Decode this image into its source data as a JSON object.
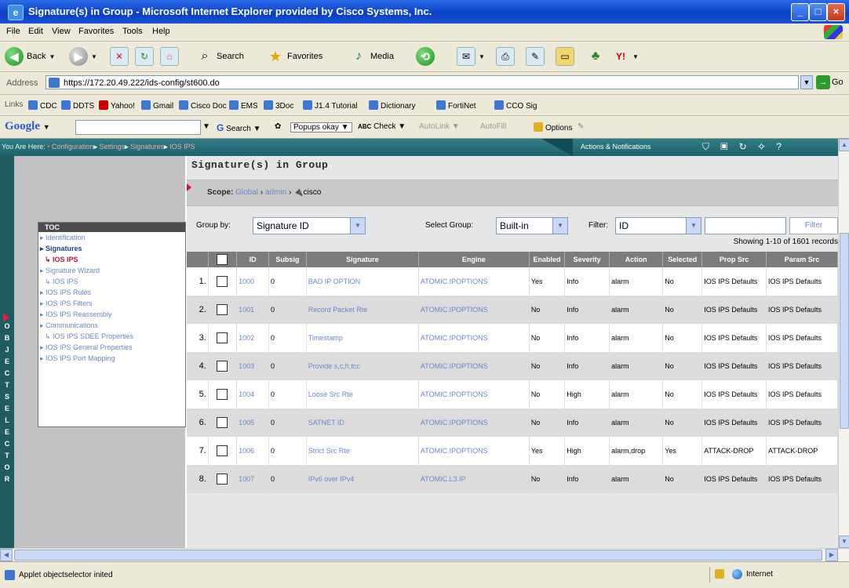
{
  "window": {
    "title": "Signature(s) in Group - Microsoft Internet Explorer provided by Cisco Systems, Inc."
  },
  "menu": [
    "File",
    "Edit",
    "View",
    "Favorites",
    "Tools",
    "Help"
  ],
  "toolbar": {
    "back": "Back",
    "search": "Search",
    "favorites": "Favorites",
    "media": "Media"
  },
  "address": {
    "label": "Address",
    "url": "https://172.20.49.222/ids-config/st600.do",
    "go": "Go"
  },
  "links": {
    "label": "Links",
    "items": [
      "CDC",
      "DDTS",
      "Yahoo!",
      "Gmail",
      "Cisco Doc",
      "EMS",
      "3Doc",
      "J1.4 Tutorial",
      "Dictionary",
      "FortiNet",
      "CCO Sig"
    ]
  },
  "googlebar": {
    "logo": "Google",
    "search": "Search",
    "popups": "Popups okay",
    "check": "Check",
    "autolink": "AutoLink",
    "autofill": "AutoFill",
    "options": "Options"
  },
  "topnav": {
    "you_are_here": "You Are Here:",
    "crumbs": [
      "Configuration",
      "Settings",
      "Signatures",
      "IOS IPS"
    ],
    "actions": "Actions & Notifications"
  },
  "selector": {
    "text": "OBJECT SELECTOR"
  },
  "toc": {
    "title": "TOC",
    "items": [
      {
        "label": "Identification",
        "style": "link"
      },
      {
        "label": "Signatures",
        "style": "bold"
      },
      {
        "label": "IOS IPS",
        "style": "red"
      },
      {
        "label": "Signature Wizard",
        "style": "link"
      },
      {
        "label": "IOS IPS",
        "style": "sub"
      },
      {
        "label": "IOS IPS Rules",
        "style": "link"
      },
      {
        "label": "IOS IPS Filters",
        "style": "link"
      },
      {
        "label": "IOS IPS Reassembly",
        "style": "link"
      },
      {
        "label": "Communications",
        "style": "link"
      },
      {
        "label": "IOS IPS SDEE Properties",
        "style": "sub"
      },
      {
        "label": "IOS IPS General Properties",
        "style": "link"
      },
      {
        "label": "IOS IPS Port Mapping",
        "style": "link"
      }
    ]
  },
  "main": {
    "title": "Signature(s) in Group",
    "scope_label": "Scope:",
    "scope": [
      "Global",
      "admin",
      "cisco"
    ],
    "group_by_label": "Group by:",
    "group_by_value": "Signature ID",
    "select_group_label": "Select Group:",
    "select_group_value": "Built-in",
    "filter_label": "Filter:",
    "filter_value": "ID",
    "filter_text": "",
    "filter_button": "Filter",
    "showing": "Showing 1-10 of 1601 records"
  },
  "table": {
    "columns": [
      "ID",
      "Subsig",
      "Signature",
      "Engine",
      "Enabled",
      "Severity",
      "Action",
      "Selected",
      "Prop Src",
      "Param Src"
    ],
    "rows": [
      {
        "n": "1.",
        "id": "1000",
        "subsig": "0",
        "signature": "BAD IP OPTION",
        "engine": "ATOMIC.IPOPTIONS",
        "enabled": "Yes",
        "severity": "Info",
        "action": "alarm",
        "selected": "No",
        "prop_src": "IOS IPS Defaults",
        "param_src": "IOS IPS Defaults"
      },
      {
        "n": "2.",
        "id": "1001",
        "subsig": "0",
        "signature": "Record Packet Rte",
        "engine": "ATOMIC.IPOPTIONS",
        "enabled": "No",
        "severity": "Info",
        "action": "alarm",
        "selected": "No",
        "prop_src": "IOS IPS Defaults",
        "param_src": "IOS IPS Defaults"
      },
      {
        "n": "3.",
        "id": "1002",
        "subsig": "0",
        "signature": "Timestamp",
        "engine": "ATOMIC.IPOPTIONS",
        "enabled": "No",
        "severity": "Info",
        "action": "alarm",
        "selected": "No",
        "prop_src": "IOS IPS Defaults",
        "param_src": "IOS IPS Defaults"
      },
      {
        "n": "4.",
        "id": "1003",
        "subsig": "0",
        "signature": "Provide s,c,h,tcc",
        "engine": "ATOMIC.IPOPTIONS",
        "enabled": "No",
        "severity": "Info",
        "action": "alarm",
        "selected": "No",
        "prop_src": "IOS IPS Defaults",
        "param_src": "IOS IPS Defaults"
      },
      {
        "n": "5.",
        "id": "1004",
        "subsig": "0",
        "signature": "Loose Src Rte",
        "engine": "ATOMIC.IPOPTIONS",
        "enabled": "No",
        "severity": "High",
        "action": "alarm",
        "selected": "No",
        "prop_src": "IOS IPS Defaults",
        "param_src": "IOS IPS Defaults"
      },
      {
        "n": "6.",
        "id": "1005",
        "subsig": "0",
        "signature": "SATNET ID",
        "engine": "ATOMIC.IPOPTIONS",
        "enabled": "No",
        "severity": "Info",
        "action": "alarm",
        "selected": "No",
        "prop_src": "IOS IPS Defaults",
        "param_src": "IOS IPS Defaults"
      },
      {
        "n": "7.",
        "id": "1006",
        "subsig": "0",
        "signature": "Strict Src Rte",
        "engine": "ATOMIC.IPOPTIONS",
        "enabled": "Yes",
        "severity": "High",
        "action": "alarm,drop",
        "selected": "Yes",
        "prop_src": "ATTACK-DROP",
        "param_src": "ATTACK-DROP"
      },
      {
        "n": "8.",
        "id": "1007",
        "subsig": "0",
        "signature": "IPv6 over IPv4",
        "engine": "ATOMIC.L3.IP",
        "enabled": "No",
        "severity": "Info",
        "action": "alarm",
        "selected": "No",
        "prop_src": "IOS IPS Defaults",
        "param_src": "IOS IPS Defaults"
      }
    ]
  },
  "status": {
    "text": "Applet objectselector inited",
    "zone": "Internet"
  }
}
